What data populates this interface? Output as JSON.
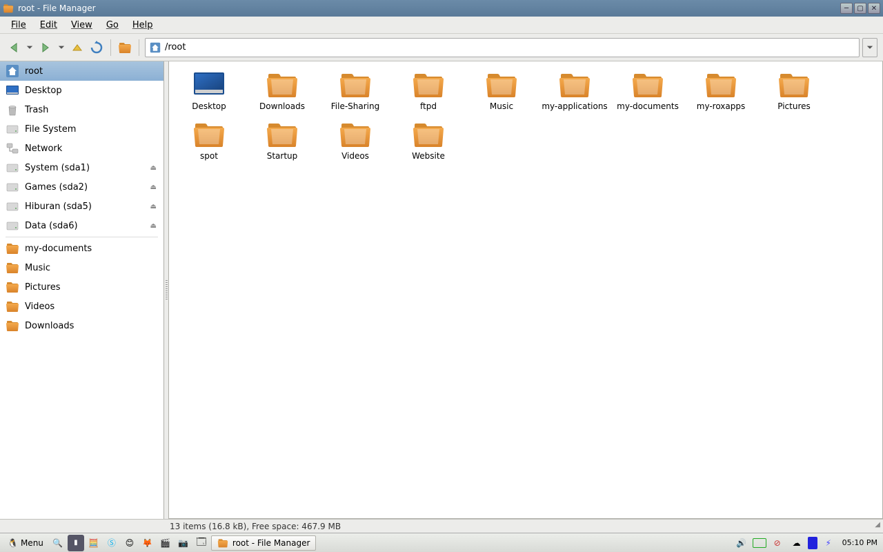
{
  "window": {
    "title": "root - File Manager"
  },
  "menubar": {
    "file": "File",
    "edit": "Edit",
    "view": "View",
    "go": "Go",
    "help": "Help"
  },
  "toolbar": {
    "path": "/root"
  },
  "sidebar": {
    "places": [
      {
        "id": "root",
        "label": "root",
        "type": "home",
        "selected": true
      },
      {
        "id": "desktop",
        "label": "Desktop",
        "type": "desktop"
      },
      {
        "id": "trash",
        "label": "Trash",
        "type": "trash"
      },
      {
        "id": "filesystem",
        "label": "File System",
        "type": "disk"
      },
      {
        "id": "network",
        "label": "Network",
        "type": "network"
      },
      {
        "id": "system",
        "label": "System (sda1)",
        "type": "disk",
        "eject": true
      },
      {
        "id": "games",
        "label": "Games (sda2)",
        "type": "disk",
        "eject": true
      },
      {
        "id": "hiburan",
        "label": "Hiburan (sda5)",
        "type": "disk",
        "eject": true
      },
      {
        "id": "data",
        "label": "Data (sda6)",
        "type": "disk",
        "eject": true
      }
    ],
    "shortcuts": [
      {
        "id": "mydocs",
        "label": "my-documents"
      },
      {
        "id": "music",
        "label": "Music"
      },
      {
        "id": "pictures",
        "label": "Pictures"
      },
      {
        "id": "videos",
        "label": "Videos"
      },
      {
        "id": "downloads",
        "label": "Downloads"
      }
    ]
  },
  "content": {
    "items": [
      {
        "id": "desktop",
        "label": "Desktop",
        "type": "desktop"
      },
      {
        "id": "downloads",
        "label": "Downloads",
        "type": "folder"
      },
      {
        "id": "filesharing",
        "label": "File-Sharing",
        "type": "folder"
      },
      {
        "id": "ftpd",
        "label": "ftpd",
        "type": "folder"
      },
      {
        "id": "music",
        "label": "Music",
        "type": "folder"
      },
      {
        "id": "myapps",
        "label": "my-applications",
        "type": "folder"
      },
      {
        "id": "mydocs",
        "label": "my-documents",
        "type": "folder"
      },
      {
        "id": "roxapps",
        "label": "my-roxapps",
        "type": "folder"
      },
      {
        "id": "pictures",
        "label": "Pictures",
        "type": "folder"
      },
      {
        "id": "spot",
        "label": "spot",
        "type": "folder"
      },
      {
        "id": "startup",
        "label": "Startup",
        "type": "folder"
      },
      {
        "id": "videos",
        "label": "Videos",
        "type": "folder"
      },
      {
        "id": "website",
        "label": "Website",
        "type": "folder"
      }
    ]
  },
  "statusbar": {
    "text": "13 items (16.8 kB), Free space: 467.9 MB"
  },
  "taskbar": {
    "menu_label": "Menu",
    "task_label": "root - File Manager",
    "clock": "05:10 PM"
  }
}
